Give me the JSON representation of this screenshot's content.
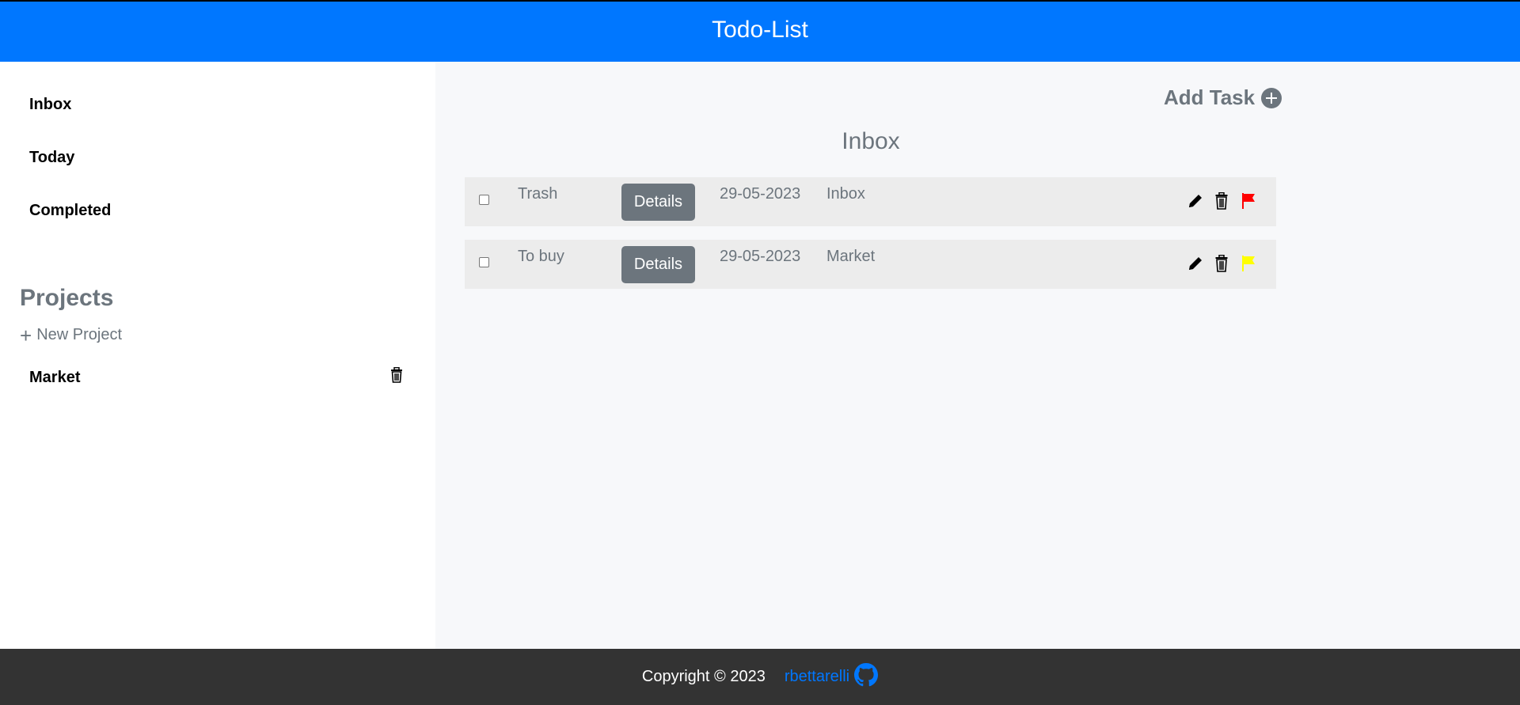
{
  "header": {
    "title": "Todo-List"
  },
  "sidebar": {
    "items": [
      {
        "label": "Inbox"
      },
      {
        "label": "Today"
      },
      {
        "label": "Completed"
      }
    ],
    "projects_title": "Projects",
    "new_project_label": "New Project",
    "projects": [
      {
        "label": "Market"
      }
    ]
  },
  "main": {
    "add_task_label": "Add Task",
    "section_title": "Inbox",
    "tasks": [
      {
        "name": "Trash",
        "details_label": "Details",
        "date": "29-05-2023",
        "project": "Inbox",
        "priority_color": "#ff0000"
      },
      {
        "name": "To buy",
        "details_label": "Details",
        "date": "29-05-2023",
        "project": "Market",
        "priority_color": "#ffff00"
      }
    ]
  },
  "footer": {
    "copyright": "Copyright © 2023",
    "author": "rbettarelli"
  },
  "colors": {
    "header_bg": "#0077ff",
    "muted": "#6c757d",
    "footer_bg": "#333333",
    "link": "#0077ff"
  }
}
